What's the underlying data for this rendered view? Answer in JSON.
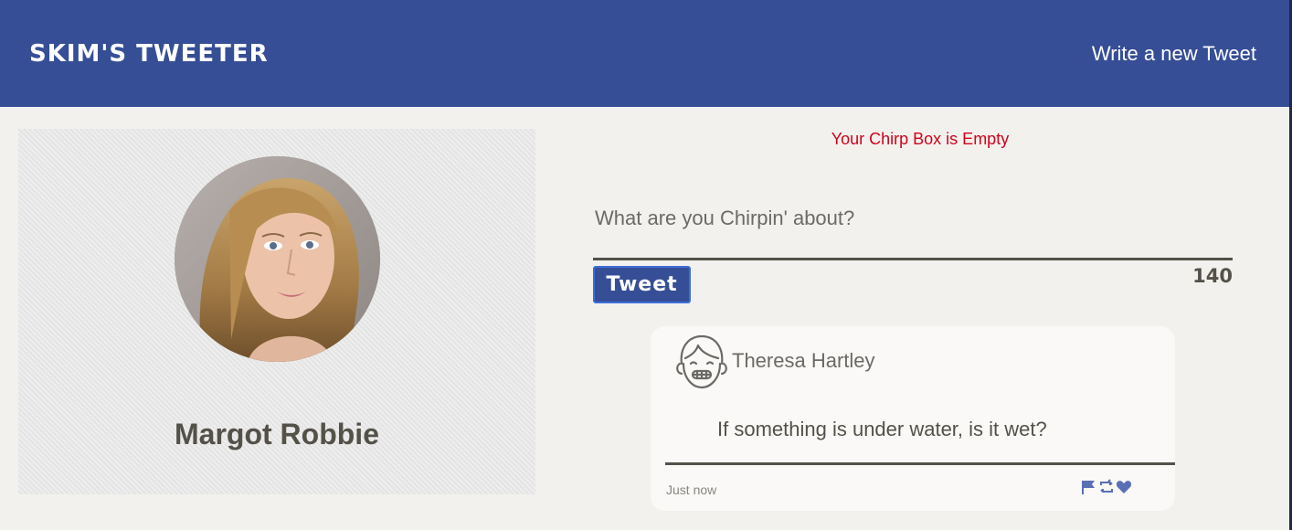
{
  "header": {
    "brand": "Skim's Tweeter",
    "compose_link": "Write a new Tweet"
  },
  "profile": {
    "name": "Margot Robbie"
  },
  "composer": {
    "error": "Your Chirp Box is Empty",
    "placeholder": "What are you Chirpin' about?",
    "button_label": "Tweet",
    "char_count": "140"
  },
  "tweets": [
    {
      "author": "Theresa Hartley",
      "text": "If something is under water, is it wet?",
      "time": "Just now",
      "actions": [
        "flag-icon",
        "retweet-icon",
        "heart-icon"
      ]
    }
  ],
  "colors": {
    "header_bg": "#364e96",
    "page_bg": "#f3f1ed",
    "error": "#d0021b",
    "icon_accent": "#5a6fb4"
  }
}
